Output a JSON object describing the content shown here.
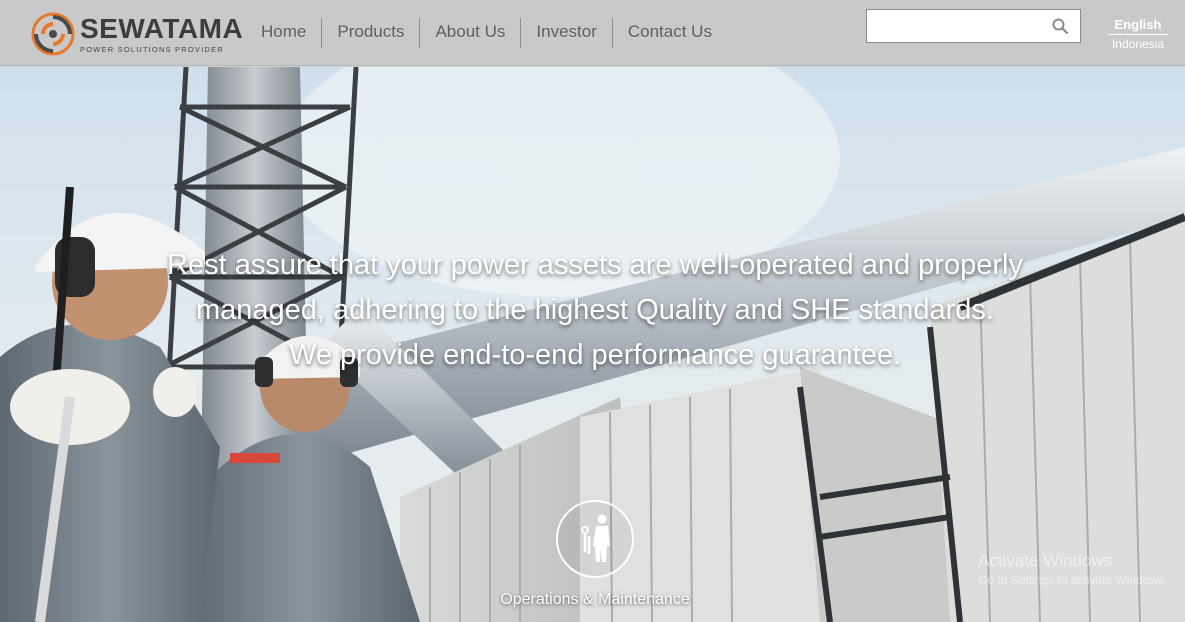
{
  "brand": {
    "name": "SEWATAMA",
    "tagline": "POWER SOLUTIONS PROVIDER",
    "colors": {
      "orange": "#e8792c",
      "gray": "#4a4a4a"
    }
  },
  "nav": {
    "items": [
      {
        "label": "Home"
      },
      {
        "label": "Products"
      },
      {
        "label": "About Us"
      },
      {
        "label": "Investor"
      },
      {
        "label": "Contact Us"
      }
    ]
  },
  "search": {
    "value": "",
    "placeholder": "",
    "icon": "search-icon"
  },
  "language": {
    "active": "English",
    "other": "Indonesia"
  },
  "hero": {
    "headline": [
      "Rest assure that your power assets are well-operated and properly",
      "managed, adhering to the highest Quality and SHE standards.",
      "We provide end-to-end performance guarantee."
    ],
    "service": {
      "label": "Operations & Maintenance",
      "icon": "worker-with-tools-icon"
    }
  },
  "os_watermark": {
    "line1": "Activate Windows",
    "line2": "Go to Settings to activate Windows."
  }
}
